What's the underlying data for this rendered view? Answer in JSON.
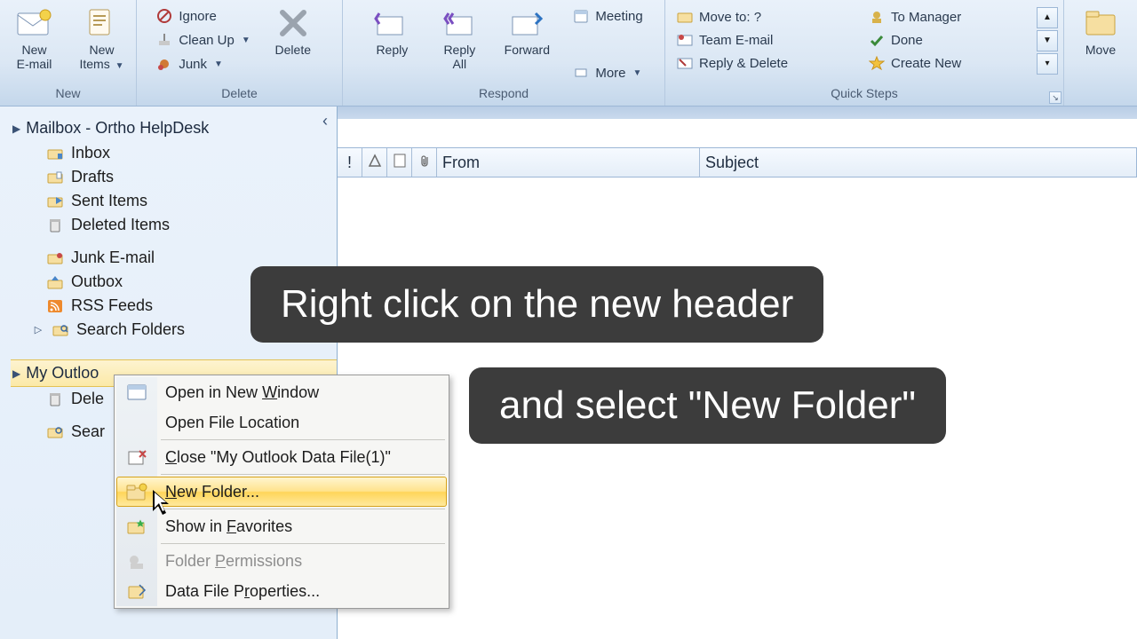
{
  "ribbon": {
    "new_group": {
      "title": "New",
      "new_email_line1": "New",
      "new_email_line2": "E-mail",
      "new_items_line1": "New",
      "new_items_line2": "Items"
    },
    "delete_group": {
      "title": "Delete",
      "ignore": "Ignore",
      "cleanup": "Clean Up",
      "junk": "Junk",
      "delete": "Delete"
    },
    "respond_group": {
      "title": "Respond",
      "reply": "Reply",
      "reply_all_line1": "Reply",
      "reply_all_line2": "All",
      "forward": "Forward",
      "meeting": "Meeting",
      "more": "More"
    },
    "quicksteps_group": {
      "title": "Quick Steps",
      "items_left": [
        "Move to: ?",
        "Team E-mail",
        "Reply & Delete"
      ],
      "items_right": [
        "To Manager",
        "Done",
        "Create New"
      ]
    },
    "move_group": {
      "move": "Move"
    }
  },
  "nav": {
    "mailbox_name": "Mailbox - Ortho HelpDesk",
    "folders": [
      "Inbox",
      "Drafts",
      "Sent Items",
      "Deleted Items",
      "Junk E-mail",
      "Outbox",
      "RSS Feeds",
      "Search Folders"
    ],
    "datafile": {
      "header": "My Outloo",
      "deleted": "Dele",
      "search": "Sear"
    }
  },
  "columns": {
    "from": "From",
    "subject": "Subject"
  },
  "context_menu": {
    "open_new_window": "Open in New Window",
    "open_file_location": "Open File Location",
    "close_file": "Close \"My Outlook Data File(1)\"",
    "new_folder": "New Folder...",
    "show_favorites": "Show in Favorites",
    "folder_permissions": "Folder Permissions",
    "data_file_properties": "Data File Properties..."
  },
  "callouts": {
    "c1": "Right click on the new header",
    "c2": "and select \"New Folder\""
  }
}
